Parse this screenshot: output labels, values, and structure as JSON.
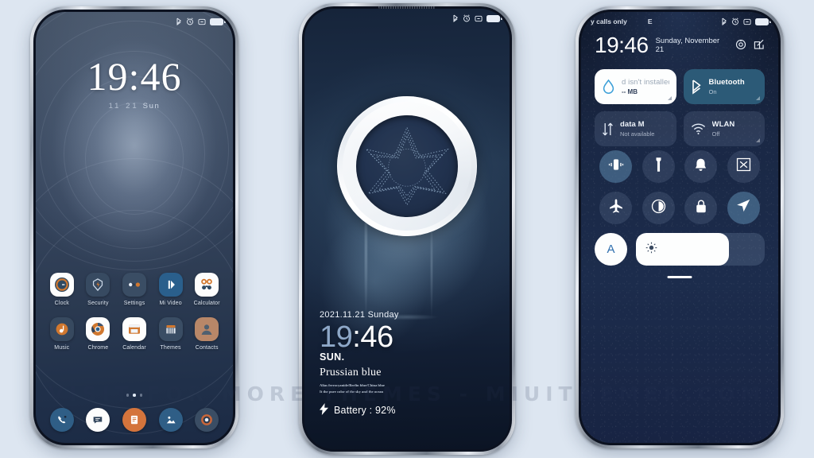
{
  "canvas": {
    "background": "#dde6f1",
    "watermark": "VISIT FOR MORE THEMES - MIUITHEMER.COM"
  },
  "theme": {
    "name": "Prussian blue",
    "accent_blue": "#2c5a77",
    "accent_orange": "#d4743c",
    "dark_navy": "#1a2845",
    "slate": "#3b4a60"
  },
  "phone1": {
    "statusbar": {
      "left": [],
      "icons": [
        "bluetooth-icon",
        "alarm-icon",
        "vibrate-icon",
        "battery-icon"
      ]
    },
    "lockscreen": {
      "time": "19:46",
      "date_md": "11 21",
      "weekday": "Sun"
    },
    "apps": [
      {
        "label": "Clock",
        "icon": "clock-icon"
      },
      {
        "label": "Security",
        "icon": "shield-icon"
      },
      {
        "label": "Settings",
        "icon": "settings-icon"
      },
      {
        "label": "Mi Video",
        "icon": "play-icon"
      },
      {
        "label": "Calculator",
        "icon": "calculator-icon"
      },
      {
        "label": "Music",
        "icon": "music-icon"
      },
      {
        "label": "Chrome",
        "icon": "chrome-icon"
      },
      {
        "label": "Calendar",
        "icon": "calendar-icon"
      },
      {
        "label": "Themes",
        "icon": "themes-icon"
      },
      {
        "label": "Contacts",
        "icon": "contacts-icon"
      }
    ],
    "page_dots": {
      "count": 3,
      "active_index": 1
    },
    "dock": [
      {
        "label": "Phone",
        "icon": "phone-icon"
      },
      {
        "label": "Messages",
        "icon": "message-icon"
      },
      {
        "label": "Notes",
        "icon": "notes-icon"
      },
      {
        "label": "Gallery",
        "icon": "gallery-icon"
      },
      {
        "label": "Camera",
        "icon": "camera-icon"
      }
    ]
  },
  "phone2": {
    "statusbar": {
      "icons": [
        "bluetooth-icon",
        "alarm-icon",
        "vibrate-icon",
        "battery-icon"
      ]
    },
    "widget": {
      "type": "ring-clock",
      "pattern": "dotted-star"
    },
    "lockscreen": {
      "date": "2021.11.21 Sunday",
      "hours": "19",
      "colon": ":",
      "minutes": "46",
      "weekday_short": "SUN.",
      "title": "Prussian blue",
      "subtitle_line1": "Alias ferrocyanide/Berlin blue/China blue",
      "subtitle_line2": "It the pure color of the sky and the ocean",
      "battery_label": "Battery",
      "battery_value": "92%",
      "battery_text": "Battery : 92%"
    }
  },
  "phone3": {
    "statusbar": {
      "carrier": "y calls only",
      "network": "E",
      "icons": [
        "bluetooth-icon",
        "alarm-icon",
        "vibrate-icon",
        "battery-icon"
      ]
    },
    "header": {
      "time": "19:46",
      "date": "Sunday, November 21",
      "icons": [
        "settings-gear-icon",
        "edit-icon"
      ]
    },
    "tiles": [
      {
        "name": "data-saver",
        "title": "d isn't installed",
        "sub": "-- MB",
        "state": "on-white",
        "icon": "water-drop-icon"
      },
      {
        "name": "bluetooth",
        "title": "Bluetooth",
        "sub": "On",
        "state": "on-blue",
        "icon": "bluetooth-icon"
      },
      {
        "name": "mobile-data",
        "title": "data      M",
        "sub": "Not available",
        "state": "off",
        "icon": "data-arrows-icon"
      },
      {
        "name": "wlan",
        "title": "WLAN",
        "sub": "Off",
        "state": "off",
        "icon": "wifi-icon"
      }
    ],
    "toggles": [
      {
        "name": "vibrate",
        "icon": "vibrate-icon",
        "active": true
      },
      {
        "name": "flashlight",
        "icon": "flashlight-icon",
        "active": false
      },
      {
        "name": "ringer",
        "icon": "bell-icon",
        "active": false
      },
      {
        "name": "screenshot",
        "icon": "screenshot-icon",
        "active": false
      },
      {
        "name": "airplane-mode",
        "icon": "airplane-icon",
        "active": false
      },
      {
        "name": "dark-mode",
        "icon": "contrast-icon",
        "active": false
      },
      {
        "name": "rotation-lock",
        "icon": "lock-icon",
        "active": false
      },
      {
        "name": "location",
        "icon": "location-arrow-icon",
        "active": true
      }
    ],
    "brightness": {
      "auto_label": "A",
      "icon": "sun-icon",
      "percent": 72
    }
  }
}
